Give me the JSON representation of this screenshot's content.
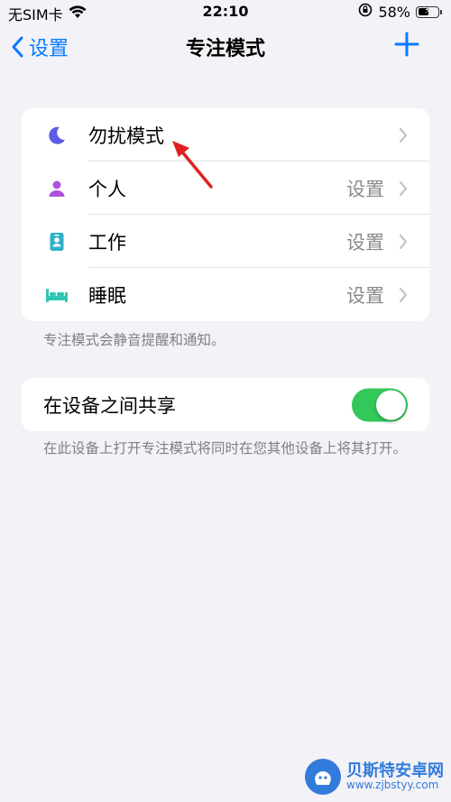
{
  "status_bar": {
    "carrier": "无SIM卡",
    "time": "22:10",
    "battery_percent": "58%",
    "battery_level": 0.58
  },
  "nav": {
    "back_label": "设置",
    "title": "专注模式"
  },
  "focus_modes": [
    {
      "label": "勿扰模式",
      "value": "",
      "icon": "moon-icon",
      "color": "#5e5ce6"
    },
    {
      "label": "个人",
      "value": "设置",
      "icon": "person-icon",
      "color": "#af52de"
    },
    {
      "label": "工作",
      "value": "设置",
      "icon": "badge-icon",
      "color": "#30b0c7"
    },
    {
      "label": "睡眠",
      "value": "设置",
      "icon": "bed-icon",
      "color": "#30c7b2"
    }
  ],
  "focus_footer": "专注模式会静音提醒和通知。",
  "share": {
    "label": "在设备之间共享",
    "enabled": true,
    "footer": "在此设备上打开专注模式将同时在您其他设备上将其打开。"
  },
  "watermark": {
    "title": "贝斯特安卓网",
    "url": "www.zjbstyy.com"
  },
  "colors": {
    "accent": "#0a7aff",
    "toggle_on": "#34c759",
    "annotation_arrow": "#e02020"
  }
}
